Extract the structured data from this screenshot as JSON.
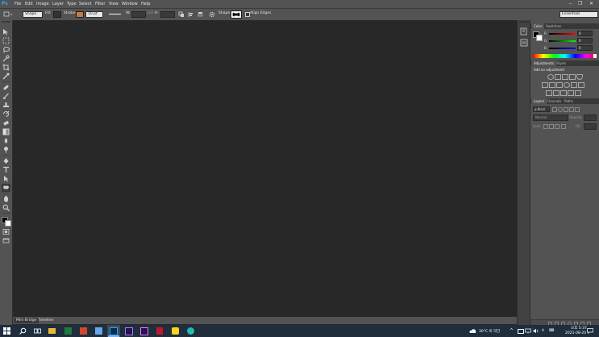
{
  "app": {
    "logo": "Ps"
  },
  "menu": [
    "File",
    "Edit",
    "Image",
    "Layer",
    "Type",
    "Select",
    "Filter",
    "View",
    "Window",
    "Help"
  ],
  "window_controls": {
    "minimize": "‒",
    "restore": "❐",
    "close": "✕"
  },
  "options_bar": {
    "tool_mode": "Shape",
    "fill_label": "Fill:",
    "stroke_label": "Stroke:",
    "stroke_width": "10 pt",
    "w_label": "W:",
    "link_label": "GO",
    "h_label": "H:",
    "shape_label": "Shape:",
    "align_edges_label": "Align Edges",
    "workspace": "Essentials",
    "stroke_color": "#c87a3e"
  },
  "tools": [
    "move-tool",
    "marquee-tool",
    "lasso-tool",
    "quick-select-tool",
    "crop-tool",
    "eyedropper-tool",
    "healing-tool",
    "brush-tool",
    "clone-stamp-tool",
    "history-brush-tool",
    "eraser-tool",
    "gradient-tool",
    "blur-tool",
    "dodge-tool",
    "pen-tool",
    "type-tool",
    "path-select-tool",
    "shape-tool",
    "hand-tool",
    "zoom-tool"
  ],
  "color_panel": {
    "tabs": [
      "Color",
      "Swatches"
    ],
    "channels": [
      {
        "label": "R",
        "value": "0"
      },
      {
        "label": "G",
        "value": "0"
      },
      {
        "label": "B",
        "value": "0"
      }
    ]
  },
  "adjustments_panel": {
    "tabs": [
      "Adjustments",
      "Styles"
    ],
    "heading": "Add an adjustment"
  },
  "layers_panel": {
    "tabs": [
      "Layers",
      "Channels",
      "Paths"
    ],
    "kind_label": "ρ Kind",
    "blend_mode": "Normal",
    "opacity_label": "Opacity:",
    "lock_label": "Lock:",
    "fill_label": "Fill:"
  },
  "doc_tabs": [
    "Mini Bridge",
    "Timeline"
  ],
  "taskbar": {
    "weather": "30°C 비 약간",
    "ime": "A",
    "time": "오후 5:37",
    "date": "2021-08-20"
  }
}
